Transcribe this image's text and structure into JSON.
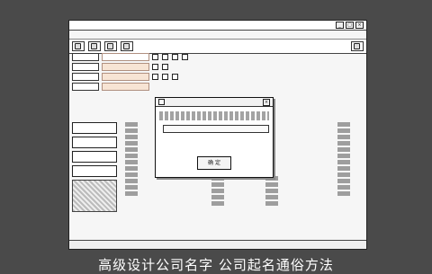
{
  "window": {
    "title": ""
  },
  "menubar": {
    "items": [
      "",
      "",
      "",
      "",
      ""
    ]
  },
  "toolbar": {
    "items": [
      "",
      "",
      "",
      "",
      ""
    ]
  },
  "form": {
    "rows": [
      {
        "label": "",
        "value": ""
      },
      {
        "label": "",
        "value": ""
      },
      {
        "label": "",
        "value": ""
      },
      {
        "label": "",
        "value": ""
      }
    ]
  },
  "nav": {
    "items": [
      "",
      "",
      "",
      ""
    ]
  },
  "dialog": {
    "title": "",
    "field1_label": "",
    "field2_label": "",
    "ok_label": "确 定"
  },
  "statusbar": {
    "text": ""
  },
  "caption": {
    "text": "高级设计公司名字 公司起名通俗方法"
  }
}
